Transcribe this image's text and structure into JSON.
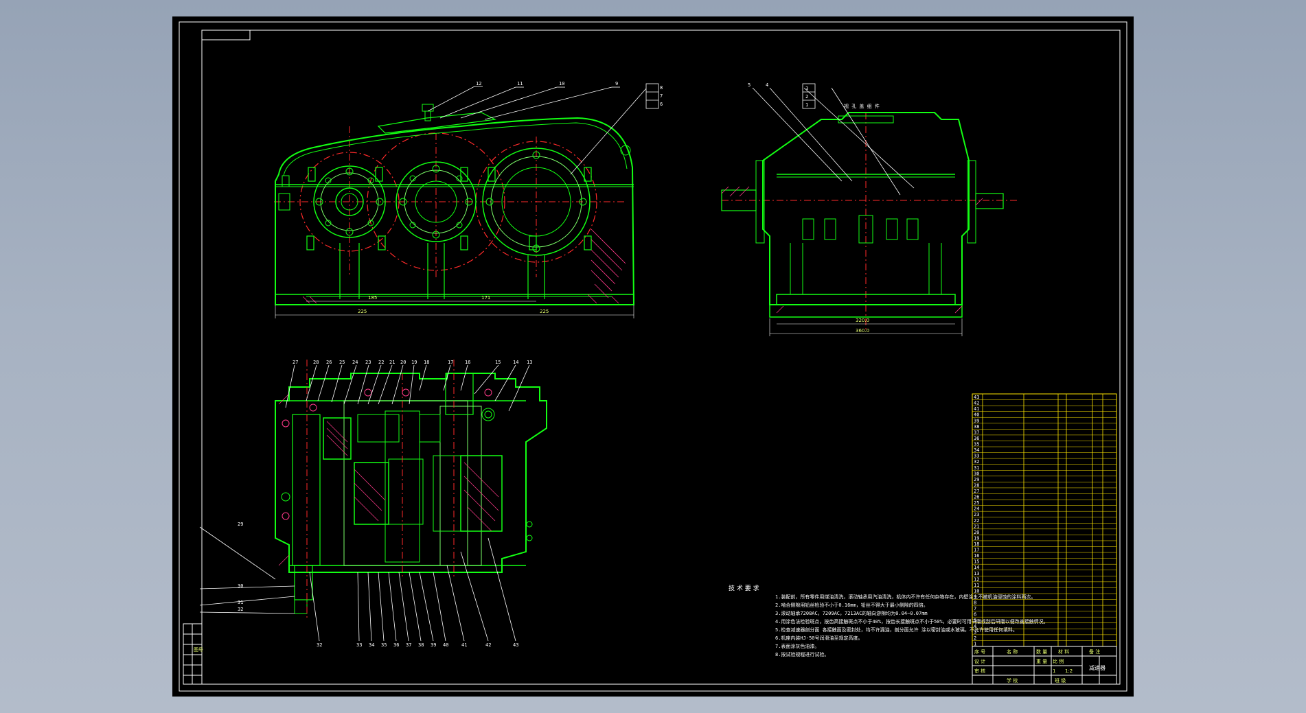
{
  "colors": {
    "background": "#96a3b6",
    "sheet": "#000000",
    "outline": "#13ff13",
    "centerline": "#ff2a2a",
    "annotation": "#ffffff",
    "hatch": "#ff3a8a",
    "dimension": "#ffe600"
  },
  "front_view": {
    "balloons": [
      "12",
      "11",
      "10",
      "9",
      "8",
      "7",
      "6"
    ],
    "dims": {
      "bottom_left": "185",
      "bottom_mid": "171",
      "overall_left": "225",
      "overall_right": "225"
    }
  },
  "side_view": {
    "balloons": [
      "5",
      "4",
      "3",
      "2",
      "1"
    ],
    "title": "视 孔 盖 组 件",
    "dims": {
      "inner": "320.0",
      "outer": "360.0"
    }
  },
  "plan_view": {
    "top_balloons": [
      "27",
      "28",
      "26",
      "25",
      "24",
      "23",
      "22",
      "21",
      "20",
      "19",
      "18",
      "17",
      "16",
      "15",
      "14",
      "13"
    ],
    "left_balloons": [
      "29",
      "30",
      "31",
      "32"
    ],
    "bottom_balloons": [
      "32",
      "33",
      "34",
      "35",
      "36",
      "37",
      "38",
      "39",
      "40",
      "41",
      "42",
      "43"
    ]
  },
  "tech_requirements": {
    "heading": "技 术 要 求",
    "lines": [
      "1.装配前，所有零件用煤油清洗，滚动轴承用汽油清洗，机体内不许有任何杂物存在，内壁涂上不被机油侵蚀的涂料两次。",
      "2.啮合侧隙用铅丝检验不小于0.16mm，铅丝不得大于最小侧隙的四倍。",
      "3.滚动轴承7208AC，7209AC，7213AC的轴向游隙均为0.04~0.07mm",
      "4.用涂色法检验斑点，按齿高接触斑点不小于40%，按齿长接触斑点不小于50%，必要时可用研磨或刮后研磨以便改善接触情况。",
      "5.检查减速器剖分面 各接触面及密封处，均不许漏油，剖分面允许 涂以密封油或水玻璃，不允许使用任何填料。",
      "6.机座内装HJ-50号润滑油至规定高度。",
      "7.表面涂灰色油漆。",
      "8.按试验规程进行试验。"
    ]
  },
  "parts_list": {
    "numbers": [
      "43",
      "42",
      "41",
      "40",
      "39",
      "38",
      "37",
      "36",
      "35",
      "34",
      "33",
      "32",
      "31",
      "30",
      "29",
      "28",
      "27",
      "26",
      "25",
      "24",
      "23",
      "22",
      "21",
      "20",
      "19",
      "18",
      "17",
      "16",
      "15",
      "14",
      "13",
      "12",
      "11",
      "10",
      "9",
      "8",
      "7",
      "6",
      "5",
      "4",
      "3",
      "2",
      "1"
    ]
  },
  "title_block": {
    "header": [
      "序 号",
      "名 称",
      "数 量",
      "材 料",
      "备 注"
    ],
    "drawing_name": "减速器",
    "scale": "1:2",
    "sheets": "1",
    "material_label": "比 例",
    "mass_label": "重 量",
    "designer": "设 计",
    "checker": "审 核",
    "school": "学 校",
    "class_label": "班 级"
  },
  "side_strip": {
    "text": "图号"
  }
}
